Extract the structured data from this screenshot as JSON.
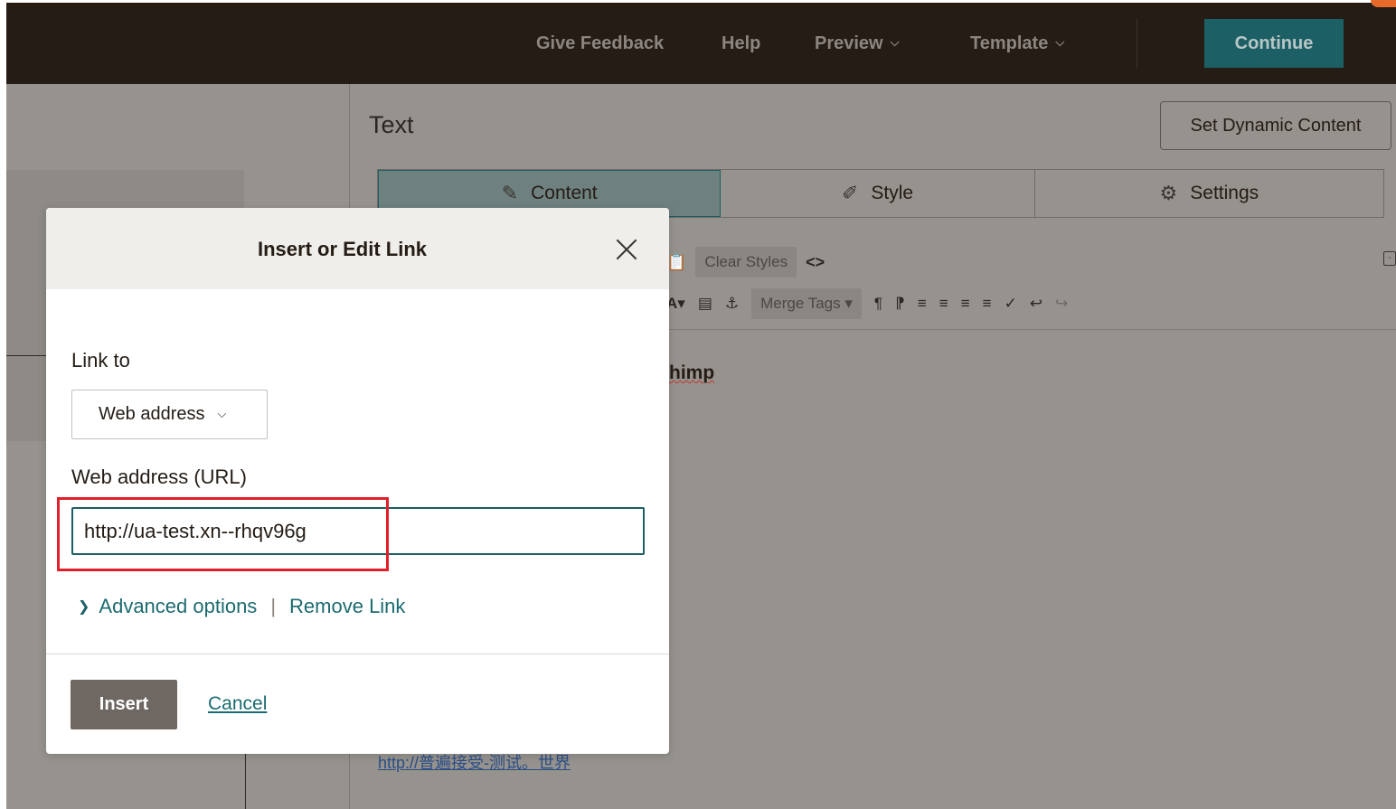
{
  "topbar": {
    "give_feedback": "Give Feedback",
    "help": "Help",
    "preview": "Preview",
    "template": "Template",
    "continue": "Continue"
  },
  "panel": {
    "title": "Text",
    "dynamic_content": "Set Dynamic Content",
    "tabs": [
      {
        "label": "Content",
        "icon": "edit-icon"
      },
      {
        "label": "Style",
        "icon": "paint-icon"
      },
      {
        "label": "Settings",
        "icon": "gear-icon"
      }
    ]
  },
  "toolbar": {
    "clear_styles": "Clear Styles",
    "merge_tags": "Merge Tags"
  },
  "editor": {
    "text_fragment": "himp",
    "link_text": "http://普遍接受-测试。世界"
  },
  "modal": {
    "title": "Insert or Edit Link",
    "link_to_label": "Link to",
    "link_to_value": "Web address",
    "url_label": "Web address (URL)",
    "url_value": "http://ua-test.xn--rhqv96g",
    "advanced_options": "Advanced options",
    "remove_link": "Remove Link",
    "insert": "Insert",
    "cancel": "Cancel"
  },
  "colors": {
    "topbar_bg": "#241c15",
    "accent": "#1c5f64",
    "highlight": "#e0202a"
  }
}
